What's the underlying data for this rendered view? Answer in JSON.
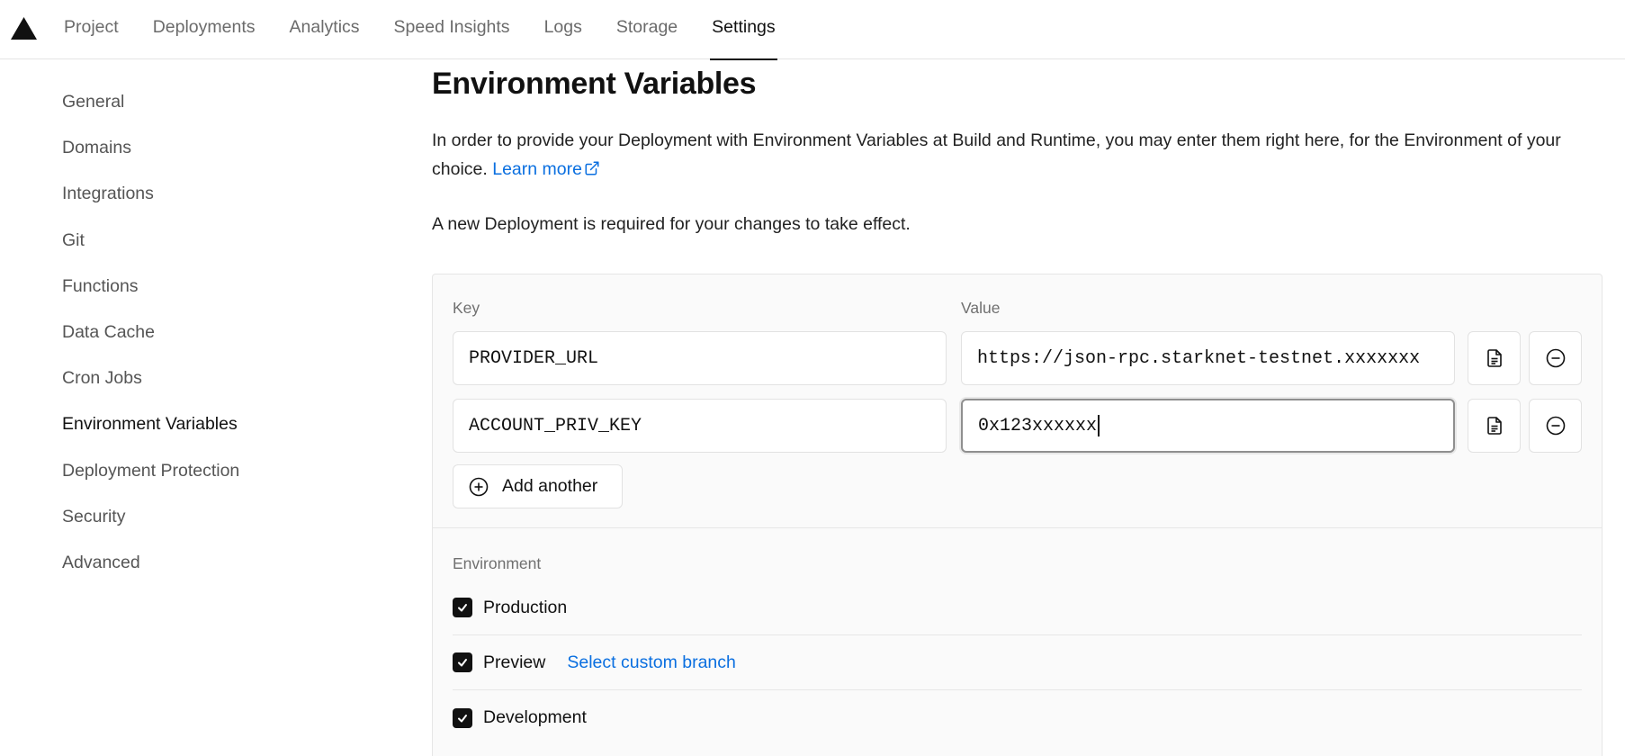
{
  "nav": {
    "tabs": [
      {
        "label": "Project"
      },
      {
        "label": "Deployments"
      },
      {
        "label": "Analytics"
      },
      {
        "label": "Speed Insights"
      },
      {
        "label": "Logs"
      },
      {
        "label": "Storage"
      },
      {
        "label": "Settings",
        "active": true
      }
    ]
  },
  "sidebar": {
    "items": [
      {
        "label": "General"
      },
      {
        "label": "Domains"
      },
      {
        "label": "Integrations"
      },
      {
        "label": "Git"
      },
      {
        "label": "Functions"
      },
      {
        "label": "Data Cache"
      },
      {
        "label": "Cron Jobs"
      },
      {
        "label": "Environment Variables",
        "active": true
      },
      {
        "label": "Deployment Protection"
      },
      {
        "label": "Security"
      },
      {
        "label": "Advanced"
      }
    ]
  },
  "main": {
    "title": "Environment Variables",
    "description": "In order to provide your Deployment with Environment Variables at Build and Runtime, you may enter them right here, for the Environment of your choice.",
    "learn_more": "Learn more",
    "note": "A new Deployment is required for your changes to take effect."
  },
  "editor": {
    "key_label": "Key",
    "value_label": "Value",
    "rows": [
      {
        "key": "PROVIDER_URL",
        "value": "https://json-rpc.starknet-testnet.xxxxxxx"
      },
      {
        "key": "ACCOUNT_PRIV_KEY",
        "value": "0x123xxxxxx"
      }
    ],
    "add_label": "Add another"
  },
  "environment": {
    "label": "Environment",
    "options": [
      {
        "name": "Production",
        "checked": true
      },
      {
        "name": "Preview",
        "checked": true,
        "link": "Select custom branch"
      },
      {
        "name": "Development",
        "checked": true
      }
    ]
  },
  "colors": {
    "accent_link": "#0a6fe0",
    "text_primary": "#111111",
    "panel_bg": "#fafafa"
  },
  "icons": {
    "logo": "triangle-logo-icon",
    "paste": "document-icon",
    "remove": "minus-circle-icon",
    "add": "plus-circle-icon",
    "external": "external-link-icon",
    "check": "check-icon"
  }
}
